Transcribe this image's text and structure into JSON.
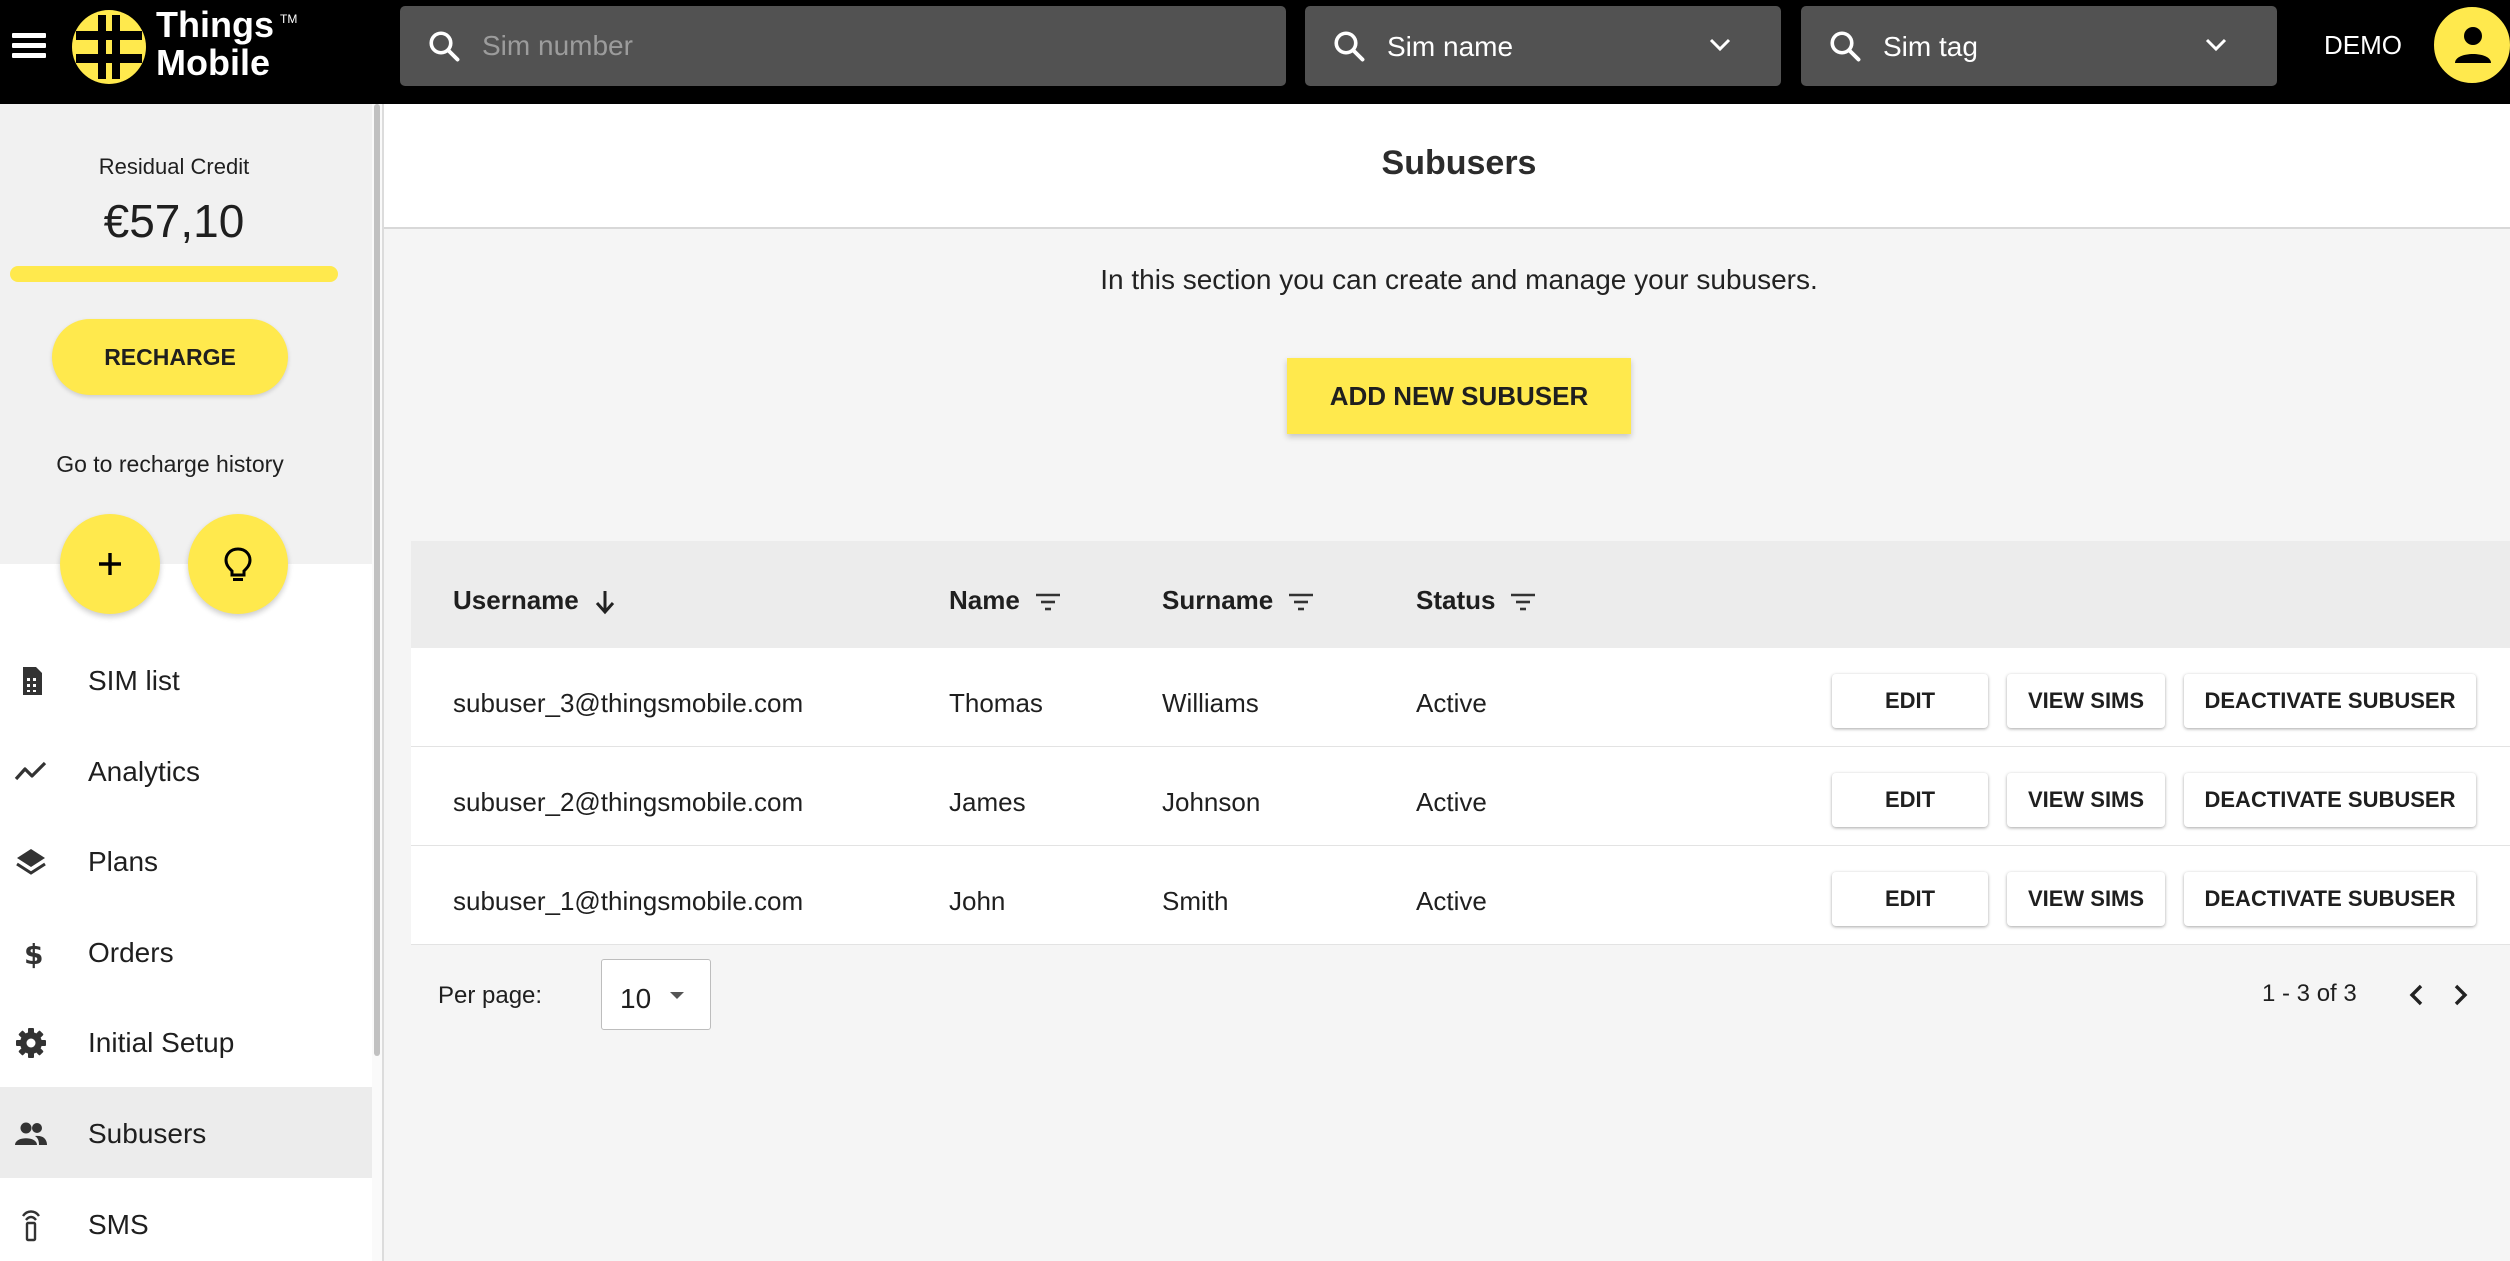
{
  "header": {
    "menu_icon": "hamburger-menu-icon",
    "logo": {
      "line1": "Things",
      "line2": "Mobile",
      "tm": "TM"
    },
    "search_sim_number": {
      "placeholder": "Sim number"
    },
    "search_sim_name": {
      "label": "Sim name"
    },
    "search_sim_tag": {
      "label": "Sim tag"
    },
    "account_label": "DEMO",
    "account_icon": "account-circle-icon"
  },
  "sidebar": {
    "credit_label": "Residual Credit",
    "credit_value": "€57,10",
    "recharge_label": "RECHARGE",
    "history_link": "Go to recharge history",
    "fab_add_icon": "plus-icon",
    "fab_tip_icon": "lightbulb-icon",
    "items": [
      {
        "label": "SIM list",
        "icon": "sim-card-icon"
      },
      {
        "label": "Analytics",
        "icon": "trending-line-icon"
      },
      {
        "label": "Plans",
        "icon": "layers-icon"
      },
      {
        "label": "Orders",
        "icon": "dollar-icon"
      },
      {
        "label": "Initial Setup",
        "icon": "gear-icon"
      },
      {
        "label": "Subusers",
        "icon": "people-icon",
        "active": true
      },
      {
        "label": "SMS",
        "icon": "sms-tower-icon"
      }
    ]
  },
  "main": {
    "title": "Subusers",
    "intro": "In this section you can create and manage your subusers.",
    "add_button": "ADD NEW SUBUSER",
    "table": {
      "columns": {
        "username": "Username",
        "name": "Name",
        "surname": "Surname",
        "status": "Status"
      },
      "rows": [
        {
          "username": "subuser_3@thingsmobile.com",
          "name": "Thomas",
          "surname": "Williams",
          "status": "Active"
        },
        {
          "username": "subuser_2@thingsmobile.com",
          "name": "James",
          "surname": "Johnson",
          "status": "Active"
        },
        {
          "username": "subuser_1@thingsmobile.com",
          "name": "John",
          "surname": "Smith",
          "status": "Active"
        }
      ],
      "actions": {
        "edit": "EDIT",
        "view_sims": "VIEW SIMS",
        "deactivate": "DEACTIVATE SUBUSER"
      }
    },
    "pagination": {
      "per_page_label": "Per page:",
      "per_page_value": "10",
      "range": "1 - 3 of 3"
    }
  },
  "colors": {
    "brand_yellow": "#ffe94d",
    "topbar": "#000000",
    "search_bg": "#525252"
  }
}
